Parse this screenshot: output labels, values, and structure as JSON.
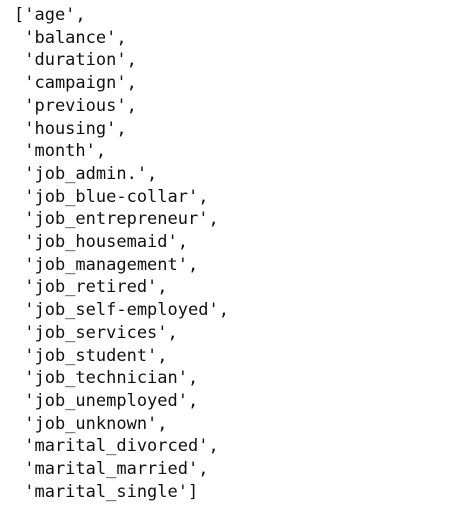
{
  "output": {
    "lines": [
      "['age',",
      " 'balance',",
      " 'duration',",
      " 'campaign',",
      " 'previous',",
      " 'housing',",
      " 'month',",
      " 'job_admin.',",
      " 'job_blue-collar',",
      " 'job_entrepreneur',",
      " 'job_housemaid',",
      " 'job_management',",
      " 'job_retired',",
      " 'job_self-employed',",
      " 'job_services',",
      " 'job_student',",
      " 'job_technician',",
      " 'job_unemployed',",
      " 'job_unknown',",
      " 'marital_divorced',",
      " 'marital_married',",
      " 'marital_single']"
    ]
  }
}
